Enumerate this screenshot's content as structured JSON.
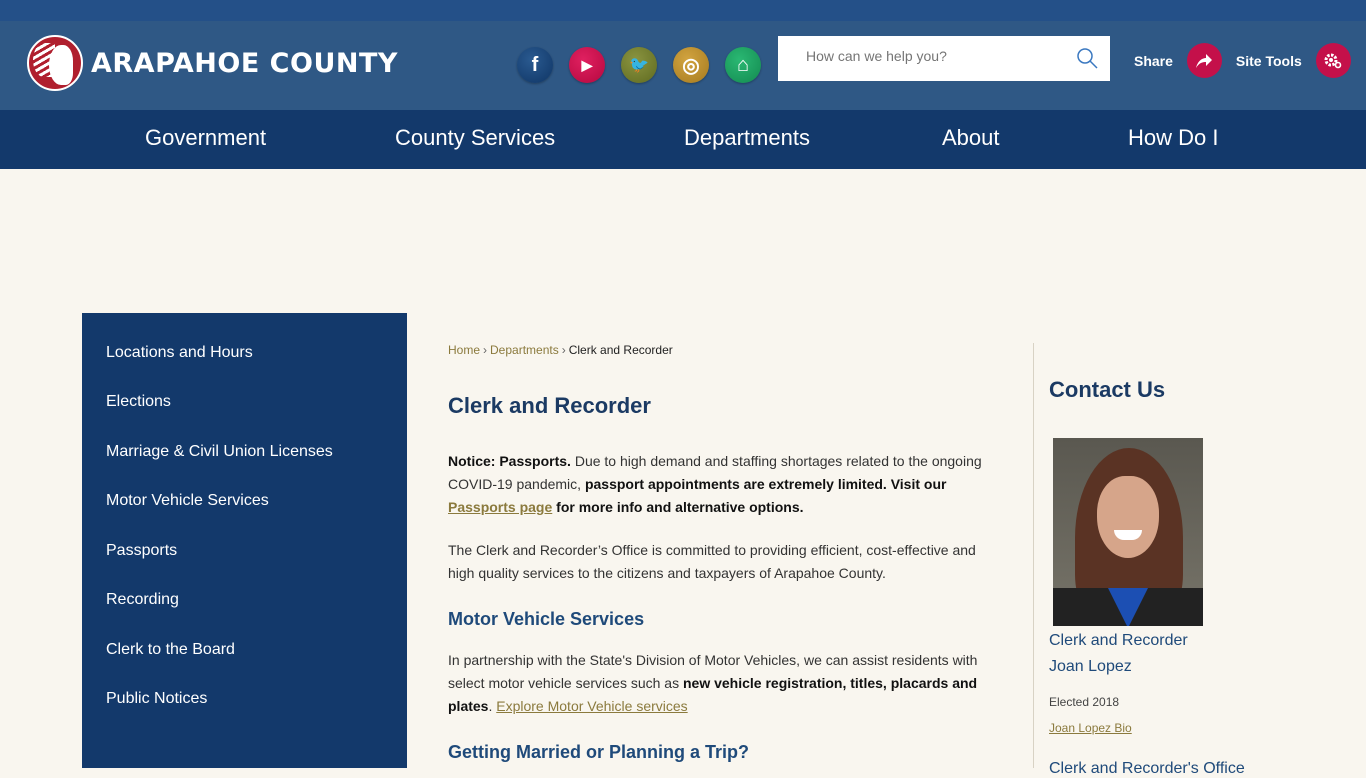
{
  "header": {
    "logo_text": "ARAPAHOE COUNTY",
    "social": [
      {
        "name": "facebook",
        "glyph": "f",
        "color": "#123f72"
      },
      {
        "name": "youtube",
        "glyph": "▶",
        "color": "#c70a4a"
      },
      {
        "name": "twitter",
        "glyph": "🐦",
        "color": "#6e7a2a"
      },
      {
        "name": "instagram",
        "glyph": "◎",
        "color": "#b58a2a"
      },
      {
        "name": "nextdoor",
        "glyph": "⌂",
        "color": "#1a9a5c"
      }
    ],
    "search_placeholder": "How can we help you?",
    "share_label": "Share",
    "site_tools_label": "Site Tools"
  },
  "nav": {
    "items": [
      "Government",
      "County Services",
      "Departments",
      "About",
      "How Do I"
    ]
  },
  "sidebar": {
    "items": [
      "Locations and Hours",
      "Elections",
      "Marriage & Civil Union Licenses",
      "Motor Vehicle Services",
      "Passports",
      "Recording",
      "Clerk to the Board",
      "Public Notices"
    ]
  },
  "breadcrumb": {
    "home": "Home",
    "departments": "Departments",
    "current": "Clerk and Recorder",
    "separator": "›"
  },
  "main": {
    "title": "Clerk and Recorder",
    "notice": {
      "lead_bold": "Notice: Passports.",
      "text1": " Due to high demand and staffing shortages related to the ongoing COVID-19 pandemic, ",
      "bold2": "passport appointments are extremely limited. Visit our ",
      "link": "Passports page",
      "bold3": " for more info and alternative options."
    },
    "intro": "The Clerk and Recorder’s Office is committed to providing efficient, cost-effective and high quality services to the citizens and taxpayers of Arapahoe County.",
    "mv_heading": "Motor Vehicle Services",
    "mv_text1": "In partnership with the State's Division of Motor Vehicles, we can assist residents with select motor vehicle services such as ",
    "mv_bold": "new vehicle registration, titles, placards and plates",
    "mv_text2": ". ",
    "mv_link": "Explore Motor Vehicle services",
    "married_heading": "Getting Married or Planning a Trip?"
  },
  "contact": {
    "heading": "Contact Us",
    "role": "Clerk and Recorder",
    "name": "Joan Lopez",
    "elected": "Elected 2018",
    "bio_link": "Joan Lopez Bio",
    "office": "Clerk and Recorder's Office"
  }
}
